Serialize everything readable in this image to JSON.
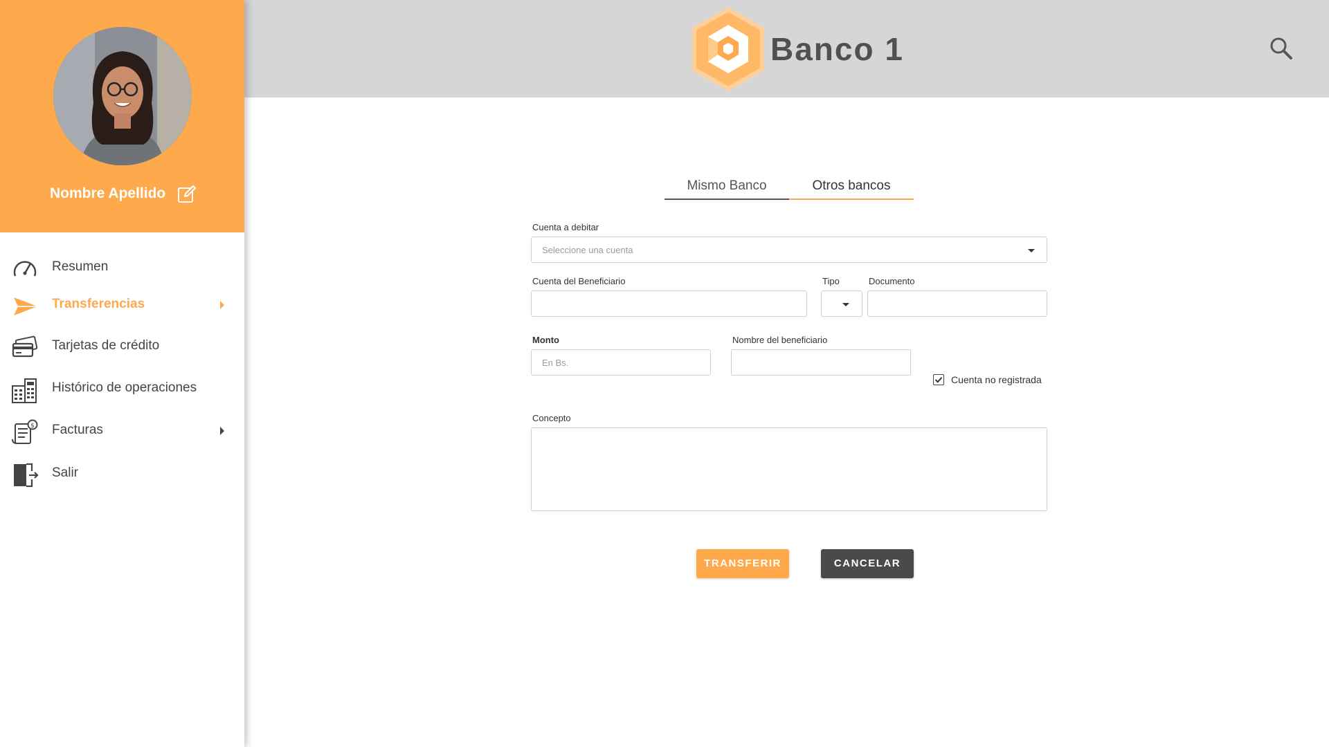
{
  "user": {
    "name": "Nombre Apellido"
  },
  "sidebar": {
    "items": [
      {
        "label": "Resumen",
        "icon": "speedometer-icon",
        "active": false
      },
      {
        "label": "Transferencias",
        "icon": "paper-plane-icon",
        "active": true
      },
      {
        "label": "Tarjetas de crédito",
        "icon": "credit-card-icon",
        "active": false
      },
      {
        "label": "Histórico de operaciones",
        "icon": "calculator-icon",
        "active": false
      },
      {
        "label": "Facturas",
        "icon": "bill-icon",
        "active": false
      },
      {
        "label": "Salir",
        "icon": "exit-door-icon",
        "active": false
      }
    ]
  },
  "header": {
    "brand": "Banco 1",
    "search_icon": "search-icon",
    "logo_icon": "hexagon-logo-icon"
  },
  "form": {
    "tabs": [
      {
        "label": "Mismo Banco"
      },
      {
        "label": "Otros bancos"
      }
    ],
    "cuenta_debitar": {
      "label": "Cuenta a debitar",
      "placeholder": "Seleccione una cuenta"
    },
    "cuenta_beneficiario": {
      "label": "Cuenta del Beneficiario",
      "value": ""
    },
    "tipo": {
      "label": "Tipo",
      "value": ""
    },
    "documento": {
      "label": "Documento",
      "value": ""
    },
    "monto": {
      "label": "Monto",
      "placeholder": "En Bs."
    },
    "nombre_beneficiario": {
      "label": "Nombre del beneficiario",
      "value": ""
    },
    "cuenta_no_registrada": {
      "label": "Cuenta no registrada",
      "checked": true
    },
    "concepto": {
      "label": "Concepto",
      "value": ""
    },
    "buttons": {
      "transferir": "TRANSFERIR",
      "cancelar": "CANCELAR"
    }
  },
  "colors": {
    "accent": "#ffa94d",
    "header_bg": "#d6d6d6",
    "dark_button": "#4a4a4a"
  }
}
